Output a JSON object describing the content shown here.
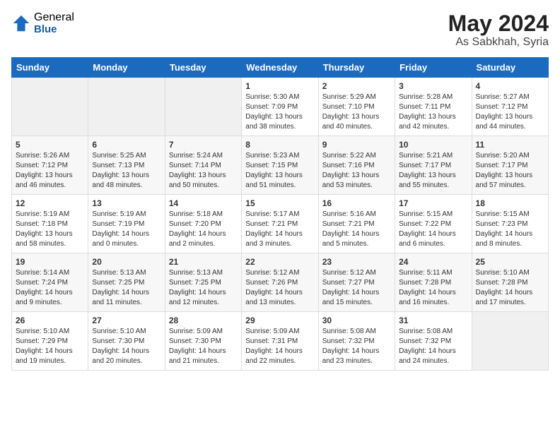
{
  "logo": {
    "general": "General",
    "blue": "Blue"
  },
  "header": {
    "month": "May 2024",
    "location": "As Sabkhah, Syria"
  },
  "weekdays": [
    "Sunday",
    "Monday",
    "Tuesday",
    "Wednesday",
    "Thursday",
    "Friday",
    "Saturday"
  ],
  "weeks": [
    [
      {
        "day": "",
        "empty": true
      },
      {
        "day": "",
        "empty": true
      },
      {
        "day": "",
        "empty": true
      },
      {
        "day": "1",
        "sunrise": "5:30 AM",
        "sunset": "7:09 PM",
        "daylight": "13 hours and 38 minutes."
      },
      {
        "day": "2",
        "sunrise": "5:29 AM",
        "sunset": "7:10 PM",
        "daylight": "13 hours and 40 minutes."
      },
      {
        "day": "3",
        "sunrise": "5:28 AM",
        "sunset": "7:11 PM",
        "daylight": "13 hours and 42 minutes."
      },
      {
        "day": "4",
        "sunrise": "5:27 AM",
        "sunset": "7:12 PM",
        "daylight": "13 hours and 44 minutes."
      }
    ],
    [
      {
        "day": "5",
        "sunrise": "5:26 AM",
        "sunset": "7:12 PM",
        "daylight": "13 hours and 46 minutes."
      },
      {
        "day": "6",
        "sunrise": "5:25 AM",
        "sunset": "7:13 PM",
        "daylight": "13 hours and 48 minutes."
      },
      {
        "day": "7",
        "sunrise": "5:24 AM",
        "sunset": "7:14 PM",
        "daylight": "13 hours and 50 minutes."
      },
      {
        "day": "8",
        "sunrise": "5:23 AM",
        "sunset": "7:15 PM",
        "daylight": "13 hours and 51 minutes."
      },
      {
        "day": "9",
        "sunrise": "5:22 AM",
        "sunset": "7:16 PM",
        "daylight": "13 hours and 53 minutes."
      },
      {
        "day": "10",
        "sunrise": "5:21 AM",
        "sunset": "7:17 PM",
        "daylight": "13 hours and 55 minutes."
      },
      {
        "day": "11",
        "sunrise": "5:20 AM",
        "sunset": "7:17 PM",
        "daylight": "13 hours and 57 minutes."
      }
    ],
    [
      {
        "day": "12",
        "sunrise": "5:19 AM",
        "sunset": "7:18 PM",
        "daylight": "13 hours and 58 minutes."
      },
      {
        "day": "13",
        "sunrise": "5:19 AM",
        "sunset": "7:19 PM",
        "daylight": "14 hours and 0 minutes."
      },
      {
        "day": "14",
        "sunrise": "5:18 AM",
        "sunset": "7:20 PM",
        "daylight": "14 hours and 2 minutes."
      },
      {
        "day": "15",
        "sunrise": "5:17 AM",
        "sunset": "7:21 PM",
        "daylight": "14 hours and 3 minutes."
      },
      {
        "day": "16",
        "sunrise": "5:16 AM",
        "sunset": "7:21 PM",
        "daylight": "14 hours and 5 minutes."
      },
      {
        "day": "17",
        "sunrise": "5:15 AM",
        "sunset": "7:22 PM",
        "daylight": "14 hours and 6 minutes."
      },
      {
        "day": "18",
        "sunrise": "5:15 AM",
        "sunset": "7:23 PM",
        "daylight": "14 hours and 8 minutes."
      }
    ],
    [
      {
        "day": "19",
        "sunrise": "5:14 AM",
        "sunset": "7:24 PM",
        "daylight": "14 hours and 9 minutes."
      },
      {
        "day": "20",
        "sunrise": "5:13 AM",
        "sunset": "7:25 PM",
        "daylight": "14 hours and 11 minutes."
      },
      {
        "day": "21",
        "sunrise": "5:13 AM",
        "sunset": "7:25 PM",
        "daylight": "14 hours and 12 minutes."
      },
      {
        "day": "22",
        "sunrise": "5:12 AM",
        "sunset": "7:26 PM",
        "daylight": "14 hours and 13 minutes."
      },
      {
        "day": "23",
        "sunrise": "5:12 AM",
        "sunset": "7:27 PM",
        "daylight": "14 hours and 15 minutes."
      },
      {
        "day": "24",
        "sunrise": "5:11 AM",
        "sunset": "7:28 PM",
        "daylight": "14 hours and 16 minutes."
      },
      {
        "day": "25",
        "sunrise": "5:10 AM",
        "sunset": "7:28 PM",
        "daylight": "14 hours and 17 minutes."
      }
    ],
    [
      {
        "day": "26",
        "sunrise": "5:10 AM",
        "sunset": "7:29 PM",
        "daylight": "14 hours and 19 minutes."
      },
      {
        "day": "27",
        "sunrise": "5:10 AM",
        "sunset": "7:30 PM",
        "daylight": "14 hours and 20 minutes."
      },
      {
        "day": "28",
        "sunrise": "5:09 AM",
        "sunset": "7:30 PM",
        "daylight": "14 hours and 21 minutes."
      },
      {
        "day": "29",
        "sunrise": "5:09 AM",
        "sunset": "7:31 PM",
        "daylight": "14 hours and 22 minutes."
      },
      {
        "day": "30",
        "sunrise": "5:08 AM",
        "sunset": "7:32 PM",
        "daylight": "14 hours and 23 minutes."
      },
      {
        "day": "31",
        "sunrise": "5:08 AM",
        "sunset": "7:32 PM",
        "daylight": "14 hours and 24 minutes."
      },
      {
        "day": "",
        "empty": true
      }
    ]
  ]
}
